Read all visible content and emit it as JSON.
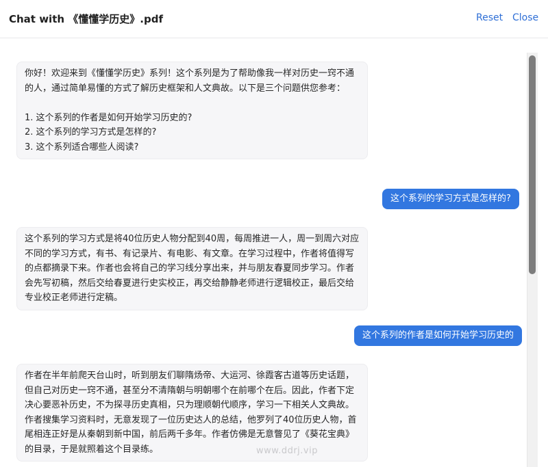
{
  "header": {
    "title": "Chat with 《懂懂学历史》.pdf",
    "reset_label": "Reset",
    "close_label": "Close"
  },
  "messages": [
    {
      "role": "assistant",
      "text": "你好！欢迎来到《懂懂学历史》系列！这个系列是为了帮助像我一样对历史一窍不通的人，通过简单易懂的方式了解历史框架和人文典故。以下是三个问题供您参考：\n\n1. 这个系列的作者是如何开始学习历史的?\n2. 这个系列的学习方式是怎样的?\n3. 这个系列适合哪些人阅读?"
    },
    {
      "role": "user",
      "text": "这个系列的学习方式是怎样的?"
    },
    {
      "role": "assistant",
      "text": "这个系列的学习方式是将40位历史人物分配到40周，每周推进一人，周一到周六对应不同的学习方式，有书、有记录片、有电影、有文章。在学习过程中，作者将值得写的点都摘录下来。作者也会将自己的学习线分享出来，并与朋友春夏同步学习。作者会先写初稿，然后交给春夏进行史实校正，再交给静静老师进行逻辑校正，最后交给专业校正老师进行定稿。"
    },
    {
      "role": "user",
      "text": "这个系列的作者是如何开始学习历史的"
    },
    {
      "role": "assistant",
      "text": "作者在半年前爬天台山时，听到朋友们聊隋炀帝、大运河、徐霞客古道等历史话题，但自己对历史一窍不通，甚至分不清隋朝与明朝哪个在前哪个在后。因此，作者下定决心要恶补历史，不为探寻历史真相，只为理顺朝代顺序，学习一下相关人文典故。作者搜集学习资料时，无意发现了一位历史达人的总结，他罗列了40位历史人物，首尾相连正好是从秦朝到新中国，前后两千多年。作者仿佛是无意瞥见了《葵花宝典》的目录，于是就照着这个目录练。"
    }
  ],
  "watermark": "www.ddrj.vip",
  "colors": {
    "accent": "#3277e0",
    "link": "#2f6fd6",
    "assistant_bubble": "#f6f6f8"
  }
}
